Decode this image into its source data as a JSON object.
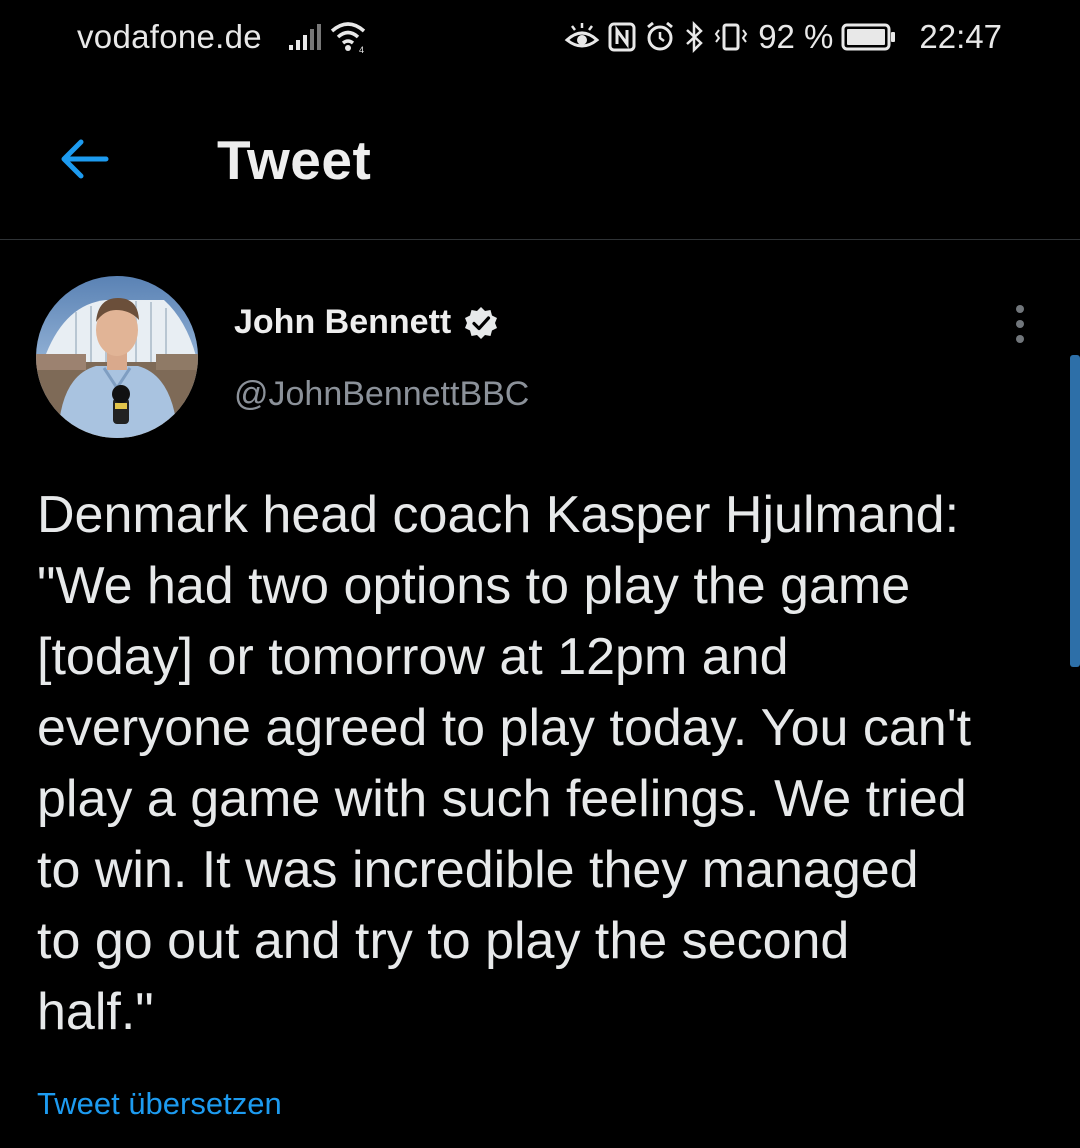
{
  "status_bar": {
    "carrier": "vodafone.de",
    "battery_percent": "92 %",
    "time": "22:47",
    "icons": [
      "signal-icon",
      "wifi-icon",
      "eye-comfort-icon",
      "nfc-icon",
      "alarm-icon",
      "bluetooth-icon",
      "vibrate-icon",
      "battery-icon"
    ]
  },
  "header": {
    "back_icon": "arrow-left-icon",
    "title": "Tweet"
  },
  "tweet": {
    "author": {
      "name": "John Bennett",
      "verified": true,
      "handle": "@JohnBennettBBC"
    },
    "text": "Denmark head coach Kasper Hjulmand:\n\"We had two options to play the game\n[today] or tomorrow at 12pm and\neveryone agreed to play today. You can't\nplay a game with such feelings. We tried\nto win. It was incredible they managed\nto go out and try to play the second\nhalf.\"",
    "translate_label": "Tweet übersetzen"
  },
  "colors": {
    "background": "#000000",
    "accent": "#1d9bf0",
    "text_primary": "#e7e9ea",
    "text_secondary": "#8b9199",
    "divider": "#2f3336"
  }
}
